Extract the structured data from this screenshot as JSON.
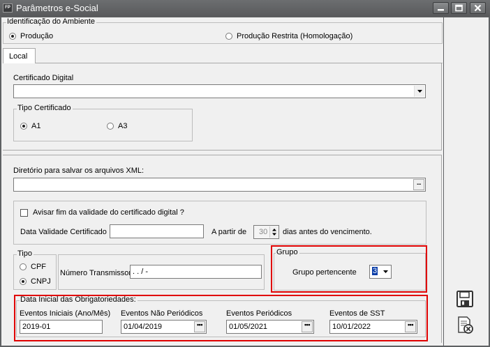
{
  "window": {
    "app_badge": "FP",
    "title": "Parâmetros e-Social"
  },
  "ambiente": {
    "legend": "Identificação do Ambiente",
    "opt_producao": "Produção",
    "opt_restrita": "Produção Restrita (Homologação)",
    "selected": "Produção"
  },
  "tabs": [
    {
      "label": "Local"
    }
  ],
  "certificado": {
    "label": "Certificado Digital",
    "value": "",
    "tipo_legend": "Tipo Certificado",
    "opt_a1": "A1",
    "opt_a3": "A3",
    "tipo_selected": "A1"
  },
  "xml": {
    "label": "Diretório para salvar os arquivos XML:",
    "value": "",
    "browse": "..."
  },
  "validade": {
    "avisar_label": "Avisar fim da validade do certificado digital ?",
    "avisar_checked": false,
    "data_label": "Data Validade Certificado",
    "data_value": "",
    "apartir_label": "A partir de",
    "dias_value": "30",
    "dias_suffix": "dias antes do vencimento."
  },
  "tipo": {
    "legend": "Tipo",
    "opt_cpf": "CPF",
    "opt_cnpj": "CNPJ",
    "selected": "CNPJ",
    "transmissor_label": "Número Transmissor",
    "transmissor_value": " .  .  /   -"
  },
  "grupo": {
    "legend": "Grupo",
    "label": "Grupo pertencente",
    "value": "3"
  },
  "obrigatoriedades": {
    "legend": "Data Inicial das Obrigatoriedades:",
    "iniciais_label": "Eventos Iniciais (Ano/Mês)",
    "iniciais_value": "2019-01",
    "nao_periodicos_label": "Eventos Não Periódicos",
    "nao_periodicos_value": "01/04/2019",
    "periodicos_label": "Eventos Periódicos",
    "periodicos_value": "01/05/2021",
    "sst_label": "Eventos de SST",
    "sst_value": "10/01/2022"
  },
  "colors": {
    "highlight": "#e00000",
    "titlebar": "#5f6163",
    "panel": "#f0f0f0"
  },
  "icons": {
    "save": "floppy-disk-icon",
    "cancel": "cancel-document-icon"
  }
}
